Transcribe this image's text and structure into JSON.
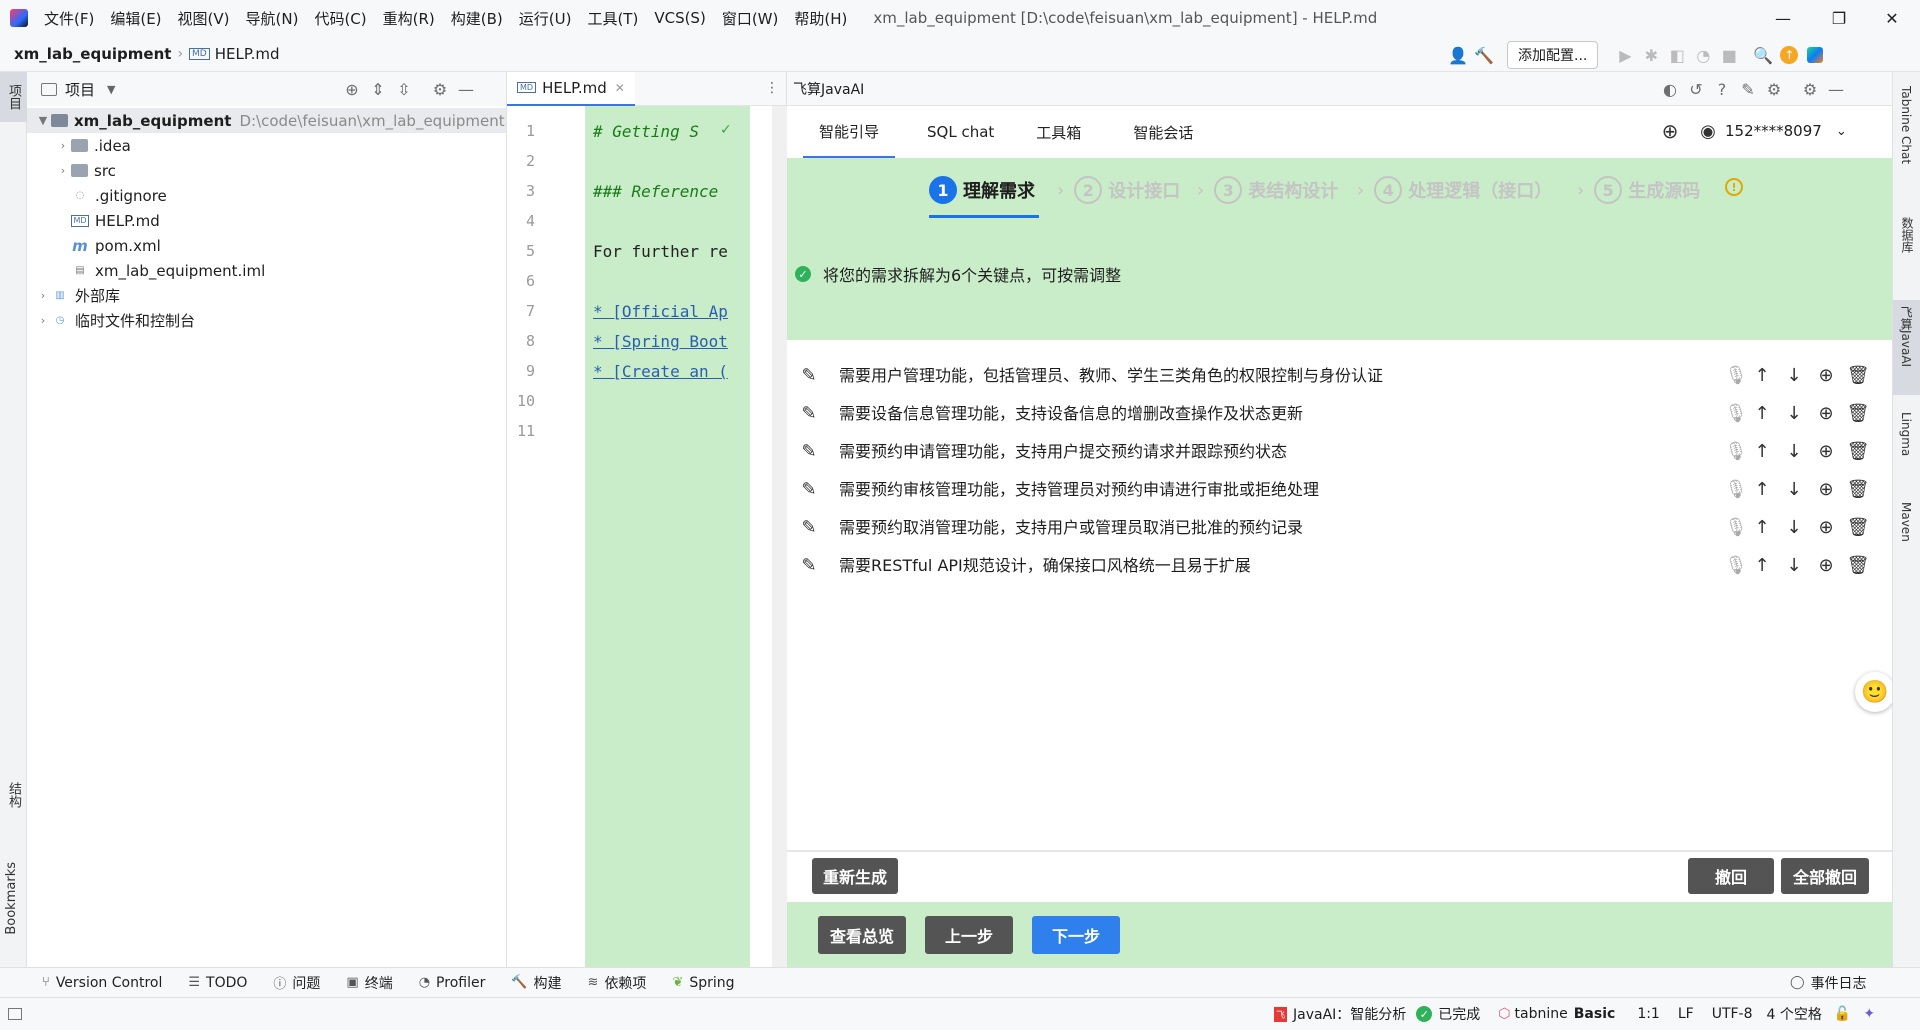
{
  "window": {
    "title": "xm_lab_equipment [D:\\code\\feisuan\\xm_lab_equipment] - HELP.md",
    "menu": [
      "文件(F)",
      "编辑(E)",
      "视图(V)",
      "导航(N)",
      "代码(C)",
      "重构(R)",
      "构建(B)",
      "运行(U)",
      "工具(T)",
      "VCS(S)",
      "窗口(W)",
      "帮助(H)"
    ]
  },
  "navbar": {
    "project": "xm_lab_equipment",
    "file": "HELP.md",
    "add_config": "添加配置..."
  },
  "left_strip": {
    "project_label": "项目",
    "structure_label": "结构",
    "bookmarks_label": "Bookmarks"
  },
  "project_panel": {
    "title": "项目",
    "root": {
      "name": "xm_lab_equipment",
      "path": "D:\\code\\feisuan\\xm_lab_equipment"
    },
    "items": [
      {
        "name": ".idea"
      },
      {
        "name": "src"
      },
      {
        "name": ".gitignore"
      },
      {
        "name": "HELP.md"
      },
      {
        "name": "pom.xml"
      },
      {
        "name": "xm_lab_equipment.iml"
      },
      {
        "name": "外部库"
      },
      {
        "name": "临时文件和控制台"
      }
    ]
  },
  "editor": {
    "tab": "HELP.md",
    "lines": [
      {
        "n": "1",
        "text": "# Getting S"
      },
      {
        "n": "2",
        "text": ""
      },
      {
        "n": "3",
        "text": "### Reference"
      },
      {
        "n": "4",
        "text": ""
      },
      {
        "n": "5",
        "text": "For further re"
      },
      {
        "n": "6",
        "text": ""
      },
      {
        "n": "7",
        "text": "* [Official Ap"
      },
      {
        "n": "8",
        "text": "* [Spring Boot"
      },
      {
        "n": "9",
        "text": "* [Create an ("
      },
      {
        "n": "10",
        "text": ""
      },
      {
        "n": "11",
        "text": ""
      }
    ]
  },
  "ai_panel": {
    "title": "飞算JavaAI",
    "tabs": [
      "智能引导",
      "SQL chat",
      "工具箱",
      "智能会话"
    ],
    "user": "152****8097",
    "steps": [
      {
        "num": "1",
        "label": "理解需求"
      },
      {
        "num": "2",
        "label": "设计接口"
      },
      {
        "num": "3",
        "label": "表结构设计"
      },
      {
        "num": "4",
        "label": "处理逻辑（接口）"
      },
      {
        "num": "5",
        "label": "生成源码"
      }
    ],
    "summary": "将您的需求拆解为6个关键点，可按需调整",
    "requirements": [
      "需要用户管理功能，包括管理员、教师、学生三类角色的权限控制与身份认证",
      "需要设备信息管理功能，支持设备信息的增删改查操作及状态更新",
      "需要预约申请管理功能，支持用户提交预约请求并跟踪预约状态",
      "需要预约审核管理功能，支持管理员对预约申请进行审批或拒绝处理",
      "需要预约取消管理功能，支持用户或管理员取消已批准的预约记录",
      "需要RESTful API规范设计，确保接口风格统一且易于扩展"
    ],
    "buttons": {
      "regenerate": "重新生成",
      "undo": "撤回",
      "undo_all": "全部撤回",
      "overview": "查看总览",
      "prev": "上一步",
      "next": "下一步"
    }
  },
  "right_strip": [
    "Tabnine Chat",
    "数据库",
    "飞算JavaAI",
    "Lingma",
    "Maven"
  ],
  "bottom_tools": [
    "Version Control",
    "TODO",
    "问题",
    "终端",
    "Profiler",
    "构建",
    "依赖项",
    "Spring"
  ],
  "event_log": "事件日志",
  "status": {
    "javaai": "JavaAI：智能分析",
    "done": "已完成",
    "tabnine_brand": "tabnine",
    "tabnine_plan": "Basic",
    "position": "1:1",
    "line_sep": "LF",
    "encoding": "UTF-8",
    "indent": "4 个空格"
  }
}
